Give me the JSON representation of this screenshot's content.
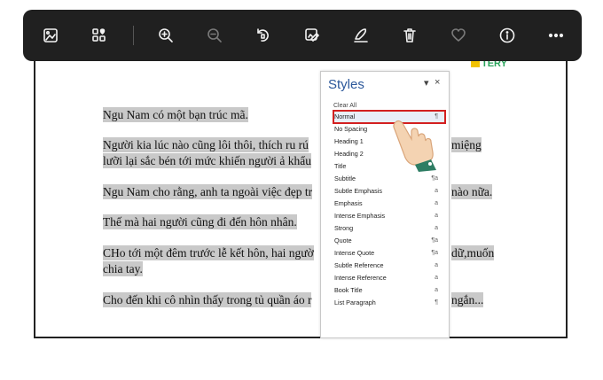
{
  "toolbar": {
    "buttons": [
      {
        "name": "image-icon"
      },
      {
        "name": "add-to-album-icon"
      },
      {
        "name": "zoom-in-icon"
      },
      {
        "name": "zoom-out-icon"
      },
      {
        "name": "rotate-icon"
      },
      {
        "name": "edit-image-icon"
      },
      {
        "name": "draw-icon"
      },
      {
        "name": "delete-icon"
      },
      {
        "name": "favorite-icon"
      },
      {
        "name": "info-icon"
      },
      {
        "name": "more-options-icon"
      }
    ]
  },
  "document": {
    "lines": [
      "Ngu Nam có một bạn trúc mã.",
      "Người kia lúc nào cũng lôi thôi, thích ru rú",
      "miệng",
      "lưỡi lại sắc bén tới mức khiến người ả khẩu",
      "Ngu Nam cho rằng, anh ta ngoài việc đẹp tr",
      "nào nữa.",
      "Thế mà hai người cũng đi đến hôn nhân.",
      "CHo tới một đêm trước lễ kết hôn, hai ngườ",
      "dữ,muốn",
      "chia tay.",
      "Cho đến khi cô nhìn thấy trong tủ quần áo r",
      "ngắn..."
    ],
    "logo_text": "TERY"
  },
  "styles_pane": {
    "title": "Styles",
    "clear_all": "Clear All",
    "items": [
      {
        "label": "Normal",
        "symbol": "¶",
        "selected": true
      },
      {
        "label": "No Spacing",
        "symbol": ""
      },
      {
        "label": "Heading 1",
        "symbol": ""
      },
      {
        "label": "Heading 2",
        "symbol": ""
      },
      {
        "label": "Title",
        "symbol": ""
      },
      {
        "label": "Subtitle",
        "symbol": "¶a"
      },
      {
        "label": "Subtle Emphasis",
        "symbol": "a"
      },
      {
        "label": "Emphasis",
        "symbol": "a"
      },
      {
        "label": "Intense Emphasis",
        "symbol": "a"
      },
      {
        "label": "Strong",
        "symbol": "a"
      },
      {
        "label": "Quote",
        "symbol": "¶a"
      },
      {
        "label": "Intense Quote",
        "symbol": "¶a"
      },
      {
        "label": "Subtle Reference",
        "symbol": "a"
      },
      {
        "label": "Intense Reference",
        "symbol": "a"
      },
      {
        "label": "Book Title",
        "symbol": "a"
      },
      {
        "label": "List Paragraph",
        "symbol": "¶"
      }
    ],
    "controls": {
      "dropdown": "▾",
      "close": "×"
    }
  }
}
